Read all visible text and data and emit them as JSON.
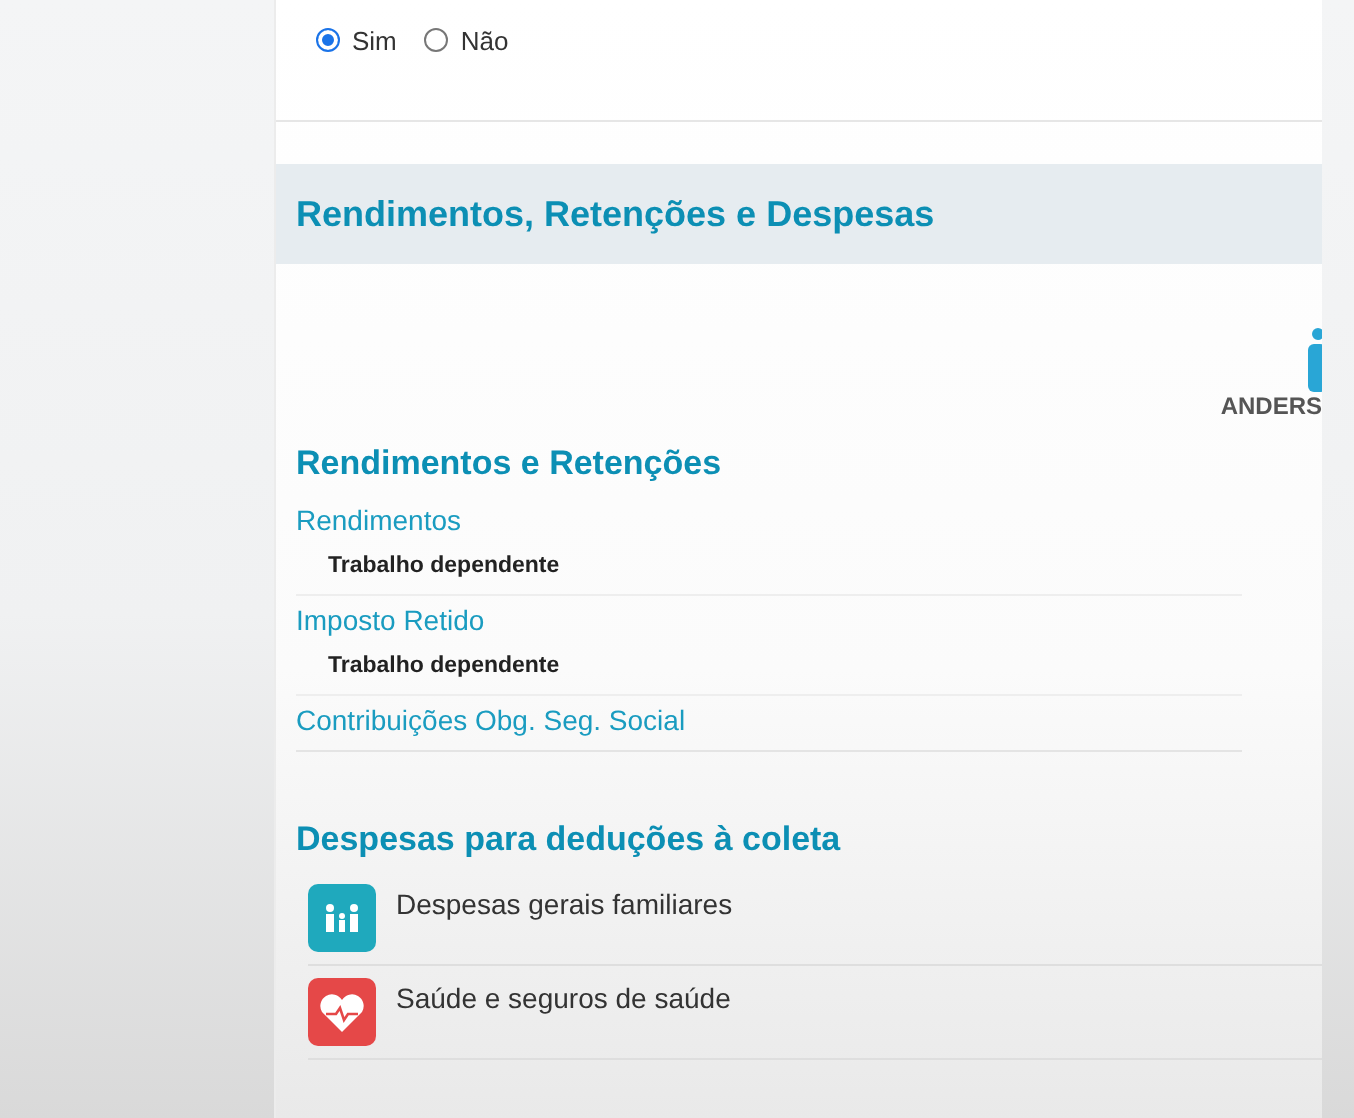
{
  "radio_options": [
    {
      "label": "Sim",
      "selected": true
    },
    {
      "label": "Não",
      "selected": false
    }
  ],
  "section": {
    "title": "Rendimentos, Retenções e Despesas",
    "user_name": "ANDERS"
  },
  "income": {
    "title": "Rendimentos e Retenções",
    "groups": [
      {
        "label": "Rendimentos",
        "items": [
          "Trabalho dependente"
        ]
      },
      {
        "label": "Imposto Retido",
        "items": [
          "Trabalho dependente"
        ]
      },
      {
        "label": "Contribuições Obg. Seg. Social"
      }
    ]
  },
  "expenses": {
    "title": "Despesas para deduções à coleta",
    "items": [
      {
        "kind": "family",
        "label": "Despesas gerais familiares",
        "color": "#1fa9bd"
      },
      {
        "kind": "health",
        "label": "Saúde e seguros de saúde",
        "color": "#e54848"
      }
    ]
  }
}
